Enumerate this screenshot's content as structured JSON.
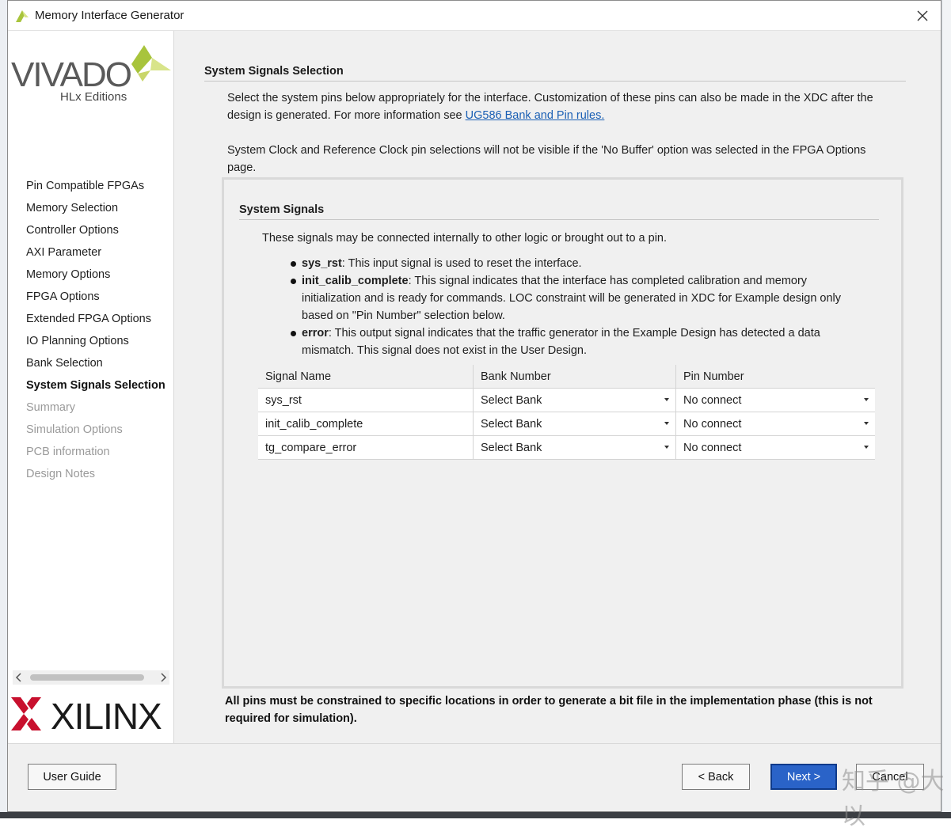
{
  "window": {
    "title": "Memory Interface Generator"
  },
  "sidebar": {
    "logo_text": "VIVADO",
    "logo_subtitle": "HLx Editions",
    "brand_text": "XILINX",
    "steps": [
      {
        "label": "Pin Compatible FPGAs",
        "state": "normal"
      },
      {
        "label": "Memory Selection",
        "state": "normal"
      },
      {
        "label": "Controller Options",
        "state": "normal"
      },
      {
        "label": "AXI Parameter",
        "state": "normal"
      },
      {
        "label": "Memory Options",
        "state": "normal"
      },
      {
        "label": "FPGA Options",
        "state": "normal"
      },
      {
        "label": "Extended FPGA Options",
        "state": "normal"
      },
      {
        "label": "IO Planning Options",
        "state": "normal"
      },
      {
        "label": "Bank Selection",
        "state": "normal"
      },
      {
        "label": "System Signals Selection",
        "state": "active"
      },
      {
        "label": "Summary",
        "state": "disabled"
      },
      {
        "label": "Simulation Options",
        "state": "disabled"
      },
      {
        "label": "PCB information",
        "state": "disabled"
      },
      {
        "label": "Design Notes",
        "state": "disabled"
      }
    ]
  },
  "main": {
    "section_title": "System Signals Selection",
    "intro_text": "Select the system pins below appropriately for the interface. Customization of these pins can also be made in the XDC after the design is generated. For more information see ",
    "intro_link": "UG586 Bank and Pin rules.",
    "clock_note": "System Clock and Reference Clock pin selections will not be visible if the 'No Buffer' option was selected in the FPGA Options page.",
    "panel": {
      "title": "System Signals",
      "description": "These signals may be connected internally to other logic or brought out to a pin.",
      "bullets": [
        {
          "name": "sys_rst",
          "text": ": This input signal is used to reset the interface."
        },
        {
          "name": "init_calib_complete",
          "text": ": This signal indicates that the interface has completed calibration and memory initialization and is ready for commands. LOC constraint will be generated in XDC for Example design only based on \"Pin Number\" selection below."
        },
        {
          "name": "error",
          "text": ": This output signal indicates that the traffic generator in the Example Design has detected a data mismatch. This signal does not exist in the User Design."
        }
      ],
      "table": {
        "columns": [
          "Signal Name",
          "Bank Number",
          "Pin Number"
        ],
        "rows": [
          {
            "signal": "sys_rst",
            "bank": "Select Bank",
            "pin": "No connect"
          },
          {
            "signal": "init_calib_complete",
            "bank": "Select Bank",
            "pin": "No connect"
          },
          {
            "signal": "tg_compare_error",
            "bank": "Select Bank",
            "pin": "No connect"
          }
        ]
      }
    },
    "footer_note": "All pins must be constrained to specific locations in order to generate a bit file in the implementation phase (this is not required for simulation)."
  },
  "buttons": {
    "user_guide": "User Guide",
    "back": "< Back",
    "next": "Next >",
    "cancel": "Cancel"
  },
  "watermark": "知乎 @大以",
  "colors": {
    "accent_green": "#a8c43c",
    "xilinx_red": "#c8102e",
    "link": "#1a5fb4",
    "next_button": "#2a63c8"
  }
}
